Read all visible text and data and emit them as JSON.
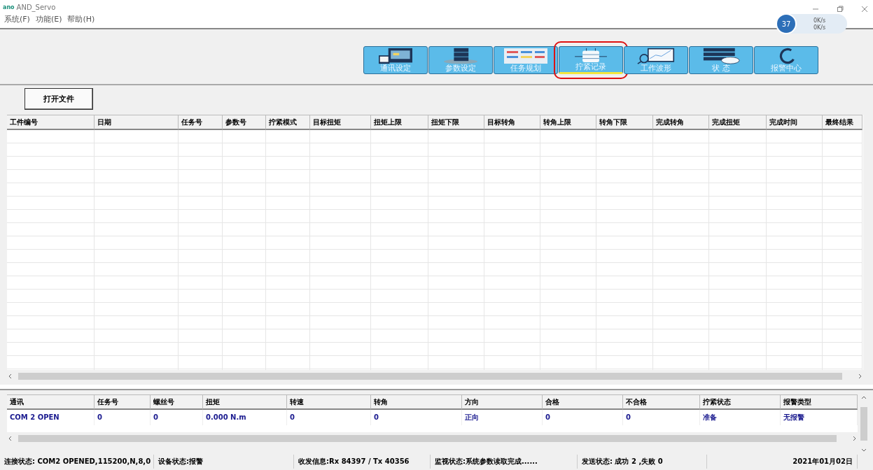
{
  "window": {
    "logo": "ano",
    "title": "AND_Servo"
  },
  "menu": [
    "系统(F)",
    "功能(E)",
    "帮助(H)"
  ],
  "toolbar": [
    {
      "label": "通讯设定",
      "selected": false
    },
    {
      "label": "参数设定",
      "selected": false
    },
    {
      "label": "任务规划",
      "selected": false
    },
    {
      "label": "拧紧记录",
      "selected": true
    },
    {
      "label": "工作波形",
      "selected": false
    },
    {
      "label": "状 态",
      "selected": false
    },
    {
      "label": "报警中心",
      "selected": false
    }
  ],
  "net_widget": {
    "value": "37",
    "up": "0K/s",
    "down": "0K/s"
  },
  "open_file_button": "打开文件",
  "records_table": {
    "columns": [
      "工件编号",
      "日期",
      "任务号",
      "参数号",
      "拧紧模式",
      "目标扭矩",
      "扭矩上限",
      "扭矩下限",
      "目标转角",
      "转角上限",
      "转角下限",
      "完成转角",
      "完成扭矩",
      "完成时间",
      "最终结果"
    ]
  },
  "monitor_table": {
    "columns": [
      "通讯",
      "任务号",
      "螺丝号",
      "扭矩",
      "转速",
      "转角",
      "方向",
      "合格",
      "不合格",
      "拧紧状态",
      "报警类型"
    ],
    "rows": [
      [
        "COM 2  OPEN",
        "0",
        "0",
        "0.000 N.m",
        "0",
        "0",
        "正向",
        "0",
        "0",
        "准备",
        "无报警"
      ]
    ]
  },
  "status_bar": [
    "连接状态: COM2 OPENED,115200,N,8,0",
    "设备状态:报警",
    "收发信息:Rx 84397 / Tx 40356",
    "监视状态:系统参数读取完成......",
    "发送状态: 成功 2 ,失败 0",
    "2021年01月02日"
  ]
}
